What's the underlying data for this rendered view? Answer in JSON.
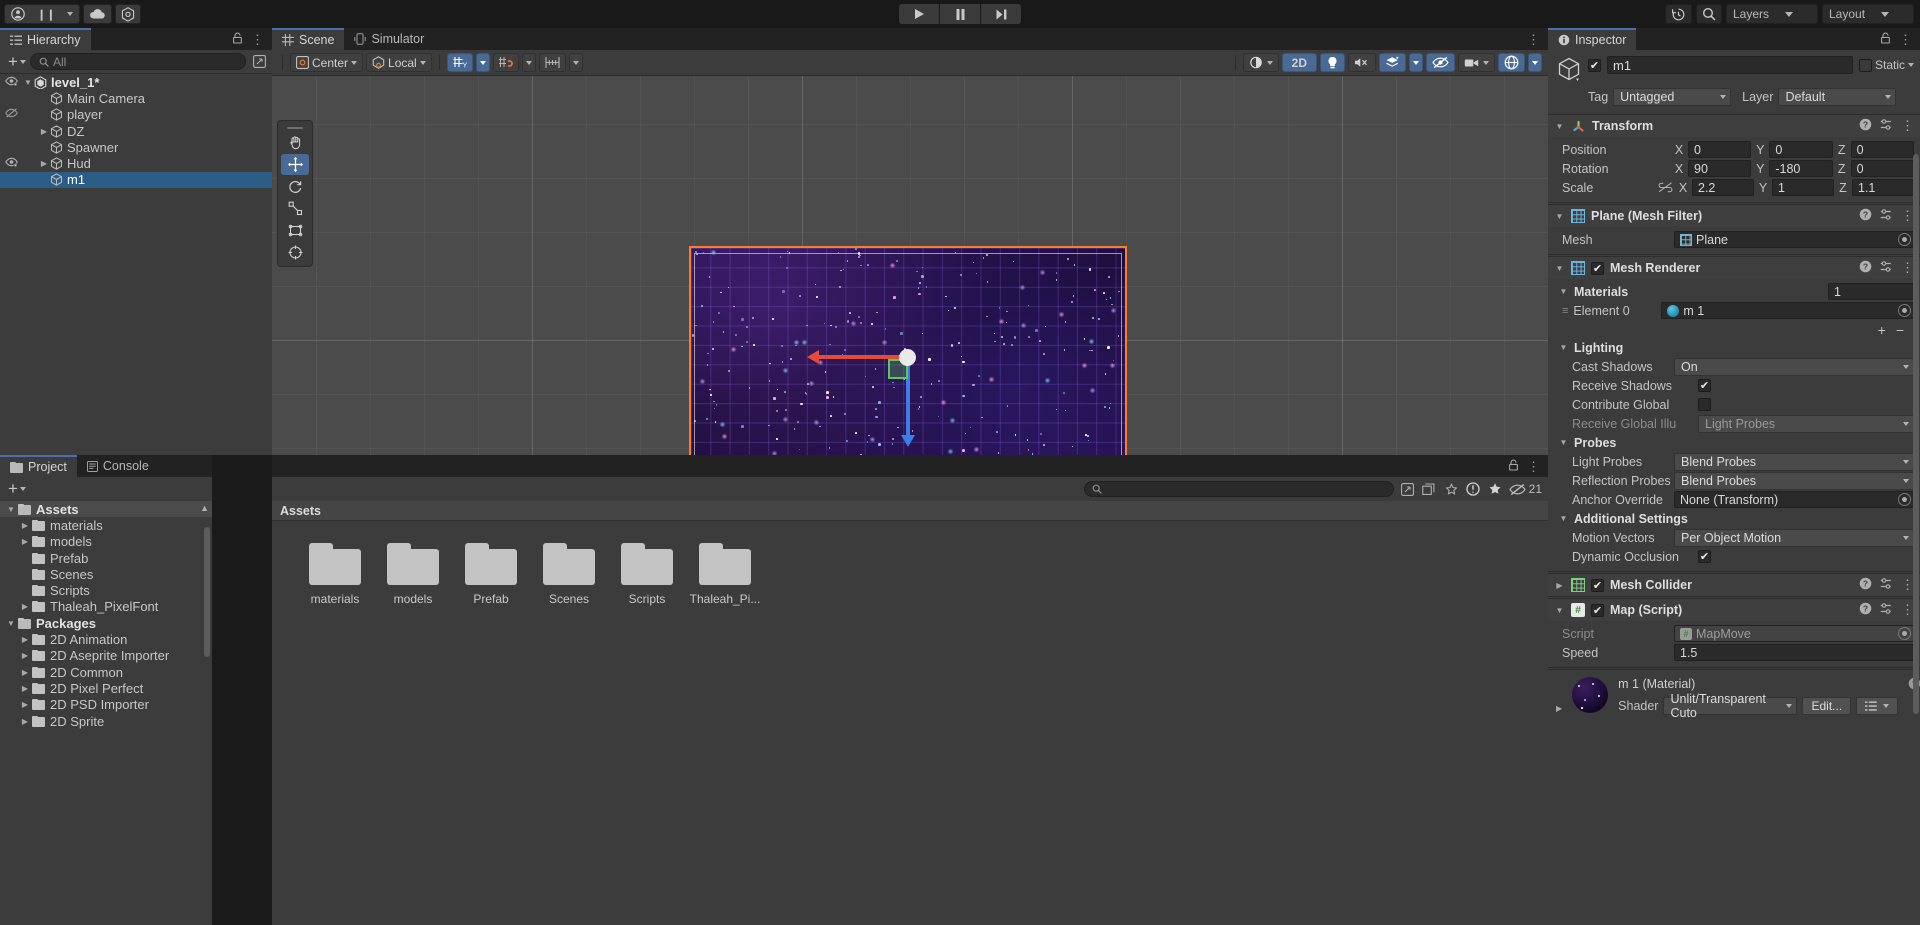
{
  "topbar": {
    "account_icon": "account-icon",
    "pause_icon": "pause-icon",
    "cloud_icon": "cloud-icon",
    "services_icon": "services-icon",
    "play_icon": "play-icon",
    "step_icon": "step-icon",
    "history_icon": "history-icon",
    "search_icon": "search-icon",
    "layers_label": "Layers",
    "layout_label": "Layout"
  },
  "hierarchy": {
    "tab_label": "Hierarchy",
    "search_placeholder": "All",
    "plus_label": "+",
    "items": [
      {
        "label": "level_1*",
        "depth": 0,
        "arrow": "down",
        "eye": true,
        "root": true,
        "selected": false
      },
      {
        "label": "Main Camera",
        "depth": 1,
        "arrow": "none",
        "eye": false,
        "root": false,
        "selected": false
      },
      {
        "label": "player",
        "depth": 1,
        "arrow": "none",
        "eye": "off",
        "root": false,
        "selected": false
      },
      {
        "label": "DZ",
        "depth": 1,
        "arrow": "right",
        "eye": false,
        "root": false,
        "selected": false
      },
      {
        "label": "Spawner",
        "depth": 1,
        "arrow": "none",
        "eye": false,
        "root": false,
        "selected": false
      },
      {
        "label": "Hud",
        "depth": 1,
        "arrow": "right",
        "eye": true,
        "root": false,
        "selected": false
      },
      {
        "label": "m1",
        "depth": 1,
        "arrow": "none",
        "eye": false,
        "root": false,
        "selected": true
      }
    ]
  },
  "scene": {
    "tabs": [
      {
        "label": "Scene",
        "icon": "grid-icon",
        "active": true
      },
      {
        "label": "Simulator",
        "icon": "device-icon",
        "active": false
      }
    ],
    "toolbar": {
      "pivot_label": "Center",
      "space_label": "Local",
      "grid_icon": "grid-snap-icon",
      "snap_icon": "magnet-icon",
      "ruler_icon": "ruler-icon",
      "shading_icon": "shading-icon",
      "twod_label": "2D",
      "light_icon": "light-icon",
      "audio_icon": "audio-mute-icon",
      "fx_icon": "effects-icon",
      "hidden_icon": "hidden-objects-icon",
      "camera_icon": "camera-icon",
      "gizmos_icon": "gizmos-icon"
    },
    "tools": [
      {
        "name": "hand-tool",
        "glyph": "✋",
        "active": false
      },
      {
        "name": "move-tool",
        "glyph": "✚",
        "active": true
      },
      {
        "name": "rotate-tool",
        "glyph": "↻",
        "active": false
      },
      {
        "name": "scale-tool",
        "glyph": "⤡",
        "active": false
      },
      {
        "name": "rect-tool",
        "glyph": "⬚",
        "active": false
      },
      {
        "name": "transform-tool",
        "glyph": "✥",
        "active": false
      }
    ]
  },
  "project": {
    "tabs": [
      {
        "label": "Project",
        "icon": "folder-icon",
        "active": true
      },
      {
        "label": "Console",
        "icon": "console-icon",
        "active": false
      }
    ],
    "search_placeholder": "",
    "breadcrumb": "Assets",
    "warning_count": "21",
    "tree": [
      {
        "label": "Assets",
        "depth": 0,
        "arrow": "down",
        "bold": true,
        "selected": true,
        "open": true
      },
      {
        "label": "materials",
        "depth": 1,
        "arrow": "right",
        "bold": false,
        "selected": false,
        "open": false
      },
      {
        "label": "models",
        "depth": 1,
        "arrow": "right",
        "bold": false,
        "selected": false,
        "open": false
      },
      {
        "label": "Prefab",
        "depth": 1,
        "arrow": "none",
        "bold": false,
        "selected": false,
        "open": false
      },
      {
        "label": "Scenes",
        "depth": 1,
        "arrow": "none",
        "bold": false,
        "selected": false,
        "open": false
      },
      {
        "label": "Scripts",
        "depth": 1,
        "arrow": "none",
        "bold": false,
        "selected": false,
        "open": false
      },
      {
        "label": "Thaleah_PixelFont",
        "depth": 1,
        "arrow": "right",
        "bold": false,
        "selected": false,
        "open": false
      },
      {
        "label": "Packages",
        "depth": 0,
        "arrow": "down",
        "bold": true,
        "selected": false,
        "open": true
      },
      {
        "label": "2D Animation",
        "depth": 1,
        "arrow": "right",
        "bold": false,
        "selected": false,
        "open": false
      },
      {
        "label": "2D Aseprite Importer",
        "depth": 1,
        "arrow": "right",
        "bold": false,
        "selected": false,
        "open": false
      },
      {
        "label": "2D Common",
        "depth": 1,
        "arrow": "right",
        "bold": false,
        "selected": false,
        "open": false
      },
      {
        "label": "2D Pixel Perfect",
        "depth": 1,
        "arrow": "right",
        "bold": false,
        "selected": false,
        "open": false
      },
      {
        "label": "2D PSD Importer",
        "depth": 1,
        "arrow": "right",
        "bold": false,
        "selected": false,
        "open": false
      },
      {
        "label": "2D Sprite",
        "depth": 1,
        "arrow": "right",
        "bold": false,
        "selected": false,
        "open": false
      }
    ],
    "assets": [
      {
        "label": "materials"
      },
      {
        "label": "models"
      },
      {
        "label": "Prefab"
      },
      {
        "label": "Scenes"
      },
      {
        "label": "Scripts"
      },
      {
        "label": "Thaleah_Pi..."
      }
    ]
  },
  "inspector": {
    "tab_label": "Inspector",
    "object_name": "m1",
    "enabled": true,
    "static_label": "Static",
    "tag_label": "Tag",
    "tag_value": "Untagged",
    "layer_label": "Layer",
    "layer_value": "Default",
    "transform": {
      "title": "Transform",
      "position_label": "Position",
      "rotation_label": "Rotation",
      "scale_label": "Scale",
      "position": {
        "x": "0",
        "y": "0",
        "z": "0"
      },
      "rotation": {
        "x": "90",
        "y": "-180",
        "z": "0"
      },
      "scale": {
        "x": "2.2",
        "y": "1",
        "z": "1.1"
      },
      "axis_x": "X",
      "axis_y": "Y",
      "axis_z": "Z"
    },
    "mesh_filter": {
      "title": "Plane (Mesh Filter)",
      "mesh_label": "Mesh",
      "mesh_value": "Plane"
    },
    "mesh_renderer": {
      "title": "Mesh Renderer",
      "enabled": true,
      "materials_label": "Materials",
      "materials_count": "1",
      "element_label": "Element 0",
      "element_value": "m 1",
      "lighting_label": "Lighting",
      "cast_shadows_label": "Cast Shadows",
      "cast_shadows_value": "On",
      "receive_shadows_label": "Receive Shadows",
      "receive_shadows_checked": true,
      "contribute_global_label": "Contribute Global",
      "contribute_global_checked": false,
      "receive_gi_label": "Receive Global Illu",
      "receive_gi_value": "Light Probes",
      "probes_label": "Probes",
      "light_probes_label": "Light Probes",
      "light_probes_value": "Blend Probes",
      "reflection_probes_label": "Reflection Probes",
      "reflection_probes_value": "Blend Probes",
      "anchor_override_label": "Anchor Override",
      "anchor_override_value": "None (Transform)",
      "additional_settings_label": "Additional Settings",
      "motion_vectors_label": "Motion Vectors",
      "motion_vectors_value": "Per Object Motion",
      "dynamic_occlusion_label": "Dynamic Occlusion",
      "dynamic_occlusion_checked": true
    },
    "mesh_collider": {
      "title": "Mesh Collider",
      "enabled": true
    },
    "map_script": {
      "title": "Map (Script)",
      "enabled": true,
      "script_label": "Script",
      "script_value": "MapMove",
      "speed_label": "Speed",
      "speed_value": "1.5"
    },
    "material": {
      "title": "m 1 (Material)",
      "shader_label": "Shader",
      "shader_value": "Unlit/Transparent Cuto",
      "edit_label": "Edit..."
    }
  }
}
